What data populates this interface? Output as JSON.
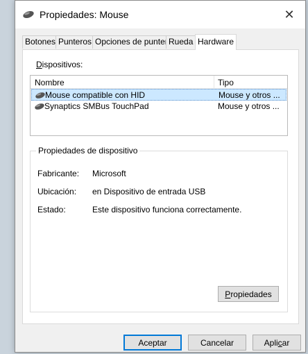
{
  "window": {
    "title": "Propiedades: Mouse",
    "close_glyph": "✕"
  },
  "tabs": [
    {
      "label": "Botones"
    },
    {
      "label": "Punteros"
    },
    {
      "label": "Opciones de puntero"
    },
    {
      "label": "Rueda"
    },
    {
      "label": "Hardware",
      "active": true
    }
  ],
  "panel": {
    "devices_label_prefix": "",
    "devices_label_mnemonic": "D",
    "devices_label_rest": "ispositivos:",
    "list": {
      "columns": {
        "name": "Nombre",
        "type": "Tipo"
      },
      "rows": [
        {
          "name": "Mouse compatible con HID",
          "type": "Mouse y otros ...",
          "selected": true,
          "icon": "mouse-icon"
        },
        {
          "name": "Synaptics SMBus TouchPad",
          "type": "Mouse y otros ...",
          "selected": false,
          "icon": "mouse-icon"
        }
      ]
    },
    "device_properties": {
      "group_title": "Propiedades de dispositivo",
      "manufacturer_label": "Fabricante:",
      "manufacturer_value": "Microsoft",
      "location_label": "Ubicación:",
      "location_value": "en Dispositivo de entrada USB",
      "status_label": "Estado:",
      "status_value": "Este dispositivo funciona correctamente.",
      "properties_button_mnemonic": "P",
      "properties_button_rest": "ropiedades"
    }
  },
  "footer": {
    "ok_label": "Aceptar",
    "cancel_label": "Cancelar",
    "apply_prefix": "Apli",
    "apply_mnemonic": "c",
    "apply_rest": "ar"
  },
  "colors": {
    "selection": "#cce8ff",
    "default_button_border": "#0078d7"
  }
}
